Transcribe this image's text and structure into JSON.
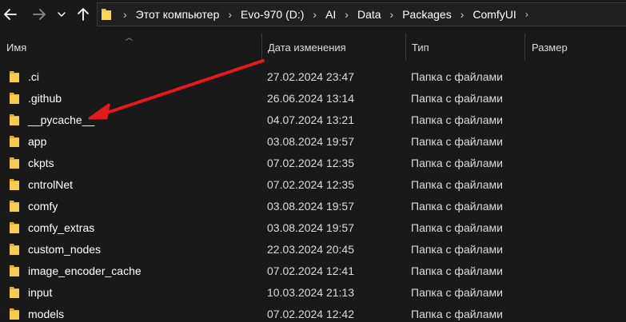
{
  "toolbar": {
    "back_icon": "arrow-left-icon",
    "forward_icon": "arrow-right-icon",
    "recent_icon": "chevron-down-icon",
    "up_icon": "arrow-up-icon"
  },
  "address": {
    "folder_icon": "folder-icon",
    "crumbs": [
      "Этот компьютер",
      "Evo-970 (D:)",
      "AI",
      "Data",
      "Packages",
      "ComfyUI"
    ]
  },
  "columns": {
    "name": "Имя",
    "date": "Дата изменения",
    "type": "Тип",
    "size": "Размер"
  },
  "files": [
    {
      "name": ".ci",
      "date": "27.02.2024 23:47",
      "type": "Папка с файлами"
    },
    {
      "name": ".github",
      "date": "26.06.2024 13:14",
      "type": "Папка с файлами"
    },
    {
      "name": "__pycache__",
      "date": "04.07.2024 13:21",
      "type": "Папка с файлами"
    },
    {
      "name": "app",
      "date": "03.08.2024 19:57",
      "type": "Папка с файлами"
    },
    {
      "name": "ckpts",
      "date": "07.02.2024 12:35",
      "type": "Папка с файлами"
    },
    {
      "name": "cntrolNet",
      "date": "07.02.2024 12:35",
      "type": "Папка с файлами"
    },
    {
      "name": "comfy",
      "date": "03.08.2024 19:57",
      "type": "Папка с файлами"
    },
    {
      "name": "comfy_extras",
      "date": "03.08.2024 19:57",
      "type": "Папка с файлами"
    },
    {
      "name": "custom_nodes",
      "date": "22.03.2024 20:45",
      "type": "Папка с файлами"
    },
    {
      "name": "image_encoder_cache",
      "date": "07.02.2024 12:41",
      "type": "Папка с файлами"
    },
    {
      "name": "input",
      "date": "10.03.2024 21:13",
      "type": "Папка с файлами"
    },
    {
      "name": "models",
      "date": "07.02.2024 12:42",
      "type": "Папка с файлами"
    }
  ],
  "colors": {
    "background": "#191919",
    "folder": "#f5c542",
    "annotation_arrow": "#e11b1b"
  }
}
